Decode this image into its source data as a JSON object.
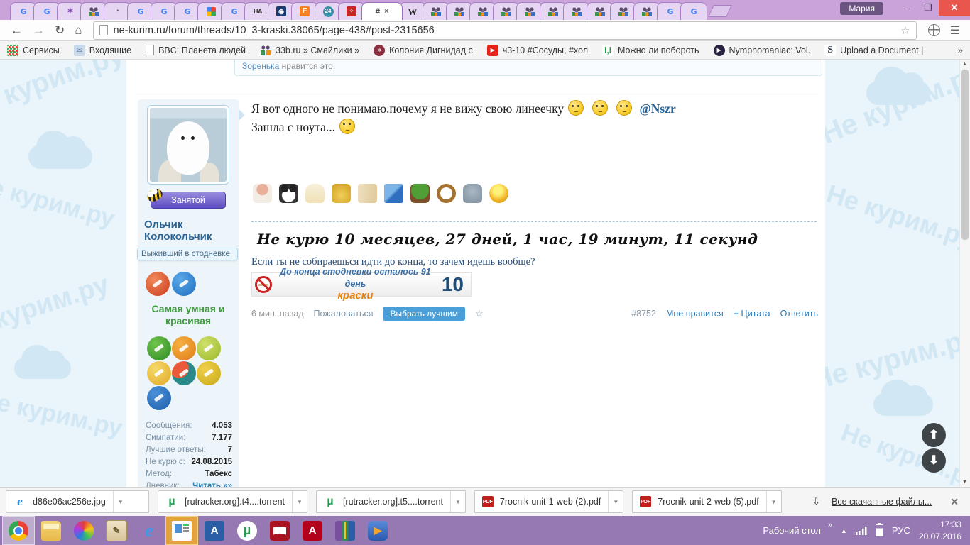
{
  "colors": {
    "titlebar": "#c9a3da",
    "taskbar": "#9679b2",
    "close": "#e8564e",
    "pagebg": "#e9f4fb",
    "wmcolor": "#d2e7f4",
    "green": "#3f9d3f",
    "orange": "#e8820c",
    "btnblue": "#4a9fd8"
  },
  "browser": {
    "profile_name": "Мария",
    "url": "ne-kurim.ru/forum/threads/10_3-kraski.38065/page-438#post-2315656",
    "active_tab_glyph": "#",
    "tab_close_glyph": "×",
    "win": {
      "min": "–",
      "max": "❐",
      "close": "✕"
    },
    "nav": {
      "back": "←",
      "fwd": "→",
      "reload": "↻",
      "home": "⌂",
      "star": "☆",
      "menu": "☰"
    },
    "tabs_before": [
      {
        "glyph": "G",
        "cls": "fav-google",
        "dn": "google-favicon"
      },
      {
        "glyph": "G",
        "cls": "fav-google",
        "dn": "google-favicon"
      },
      {
        "glyph": "✶",
        "cls": "fav-butterfly",
        "dn": "butterfly-favicon"
      },
      {
        "glyph": "",
        "cls": "fav-people",
        "dn": "forum-people-favicon"
      },
      {
        "glyph": "◔",
        "cls": "fav-circle-dark",
        "dn": "dark-circle-favicon"
      },
      {
        "glyph": "G",
        "cls": "fav-google",
        "dn": "google-favicon"
      },
      {
        "glyph": "G",
        "cls": "fav-google",
        "dn": "google-favicon"
      },
      {
        "glyph": "G",
        "cls": "fav-google",
        "dn": "google-favicon"
      },
      {
        "glyph": "",
        "cls": "fav-grid",
        "dn": "colored-grid-favicon"
      },
      {
        "glyph": "G",
        "cls": "fav-google",
        "dn": "google-favicon"
      },
      {
        "glyph": "НА",
        "cls": "fav-ha",
        "dn": "ha-favicon"
      },
      {
        "glyph": "◉",
        "cls": "fav-film",
        "dn": "film-favicon"
      },
      {
        "glyph": "F",
        "cls": "fav-f-orange",
        "dn": "f-orange-favicon"
      },
      {
        "glyph": "24",
        "cls": "fav-24",
        "dn": "24-favicon"
      },
      {
        "glyph": "⁘",
        "cls": "fav-red-app",
        "dn": "red-app-favicon"
      }
    ],
    "tabs_after": [
      {
        "glyph": "W",
        "cls": "fav-wiki",
        "dn": "wikipedia-favicon"
      },
      {
        "glyph": "",
        "cls": "fav-people",
        "dn": "forum-people-favicon"
      },
      {
        "glyph": "",
        "cls": "fav-people",
        "dn": "forum-people-favicon"
      },
      {
        "glyph": "",
        "cls": "fav-people",
        "dn": "forum-people-favicon"
      },
      {
        "glyph": "",
        "cls": "fav-people",
        "dn": "forum-people-favicon"
      },
      {
        "glyph": "",
        "cls": "fav-people",
        "dn": "forum-people-favicon"
      },
      {
        "glyph": "",
        "cls": "fav-people",
        "dn": "forum-people-favicon"
      },
      {
        "glyph": "",
        "cls": "fav-people",
        "dn": "forum-people-favicon"
      },
      {
        "glyph": "",
        "cls": "fav-people",
        "dn": "forum-people-favicon"
      },
      {
        "glyph": "",
        "cls": "fav-people",
        "dn": "forum-people-favicon"
      },
      {
        "glyph": "",
        "cls": "fav-people",
        "dn": "forum-people-favicon"
      },
      {
        "glyph": "G",
        "cls": "fav-google",
        "dn": "google-favicon"
      },
      {
        "glyph": "G",
        "cls": "fav-google",
        "dn": "google-favicon"
      }
    ],
    "bookmarks": [
      {
        "label": "Сервисы",
        "cls": "ic-apps",
        "glyph": "",
        "dn": "bookmark-services"
      },
      {
        "label": "Входящие",
        "cls": "ic-mail",
        "glyph": "✉",
        "dn": "bookmark-inbox"
      },
      {
        "label": "BBC: Планета людей",
        "cls": "ic-page",
        "glyph": "",
        "dn": "bookmark-bbc"
      },
      {
        "label": "33b.ru » Смайлики »",
        "cls": "ic-people",
        "glyph": "",
        "dn": "bookmark-33b"
      },
      {
        "label": "Колония Дигнидад с",
        "cls": "ic-chev",
        "glyph": "»",
        "dn": "bookmark-colonia"
      },
      {
        "label": "ч3-10 #Сосуды, #хол",
        "cls": "ic-yt",
        "glyph": "▶",
        "dn": "bookmark-youtube"
      },
      {
        "label": "Можно ли побороть",
        "cls": "ic-green",
        "glyph": "ǀ,ǀ",
        "dn": "bookmark-green"
      },
      {
        "label": "Nymphomaniac: Vol.",
        "cls": "ic-play",
        "glyph": "▶",
        "dn": "bookmark-nymphomaniac"
      },
      {
        "label": "Upload a Document |",
        "cls": "ic-scribd",
        "glyph": "S",
        "dn": "bookmark-scribd"
      }
    ],
    "bookmarks_overflow": "»"
  },
  "page": {
    "watermark_text": "Не курим.ру",
    "likebar": {
      "user": "Зоренька",
      "text": " нравится это."
    },
    "post": {
      "line1": "Я вот одного не понимаю.почему я не вижу свою линеечку",
      "mention": "@Nszr",
      "line2": "Зашла с ноута...",
      "trophies": [
        {
          "cls": "tr-nurse",
          "dn": "trophy-nurse-icon"
        },
        {
          "cls": "tr-panda",
          "dn": "trophy-panda-icon"
        },
        {
          "cls": "tr-cocktail",
          "dn": "trophy-cocktail-icon"
        },
        {
          "cls": "tr-coins",
          "dn": "trophy-coins-icon"
        },
        {
          "cls": "tr-scroll",
          "dn": "trophy-scroll-icon"
        },
        {
          "cls": "tr-pencil",
          "dn": "trophy-pencil-icon"
        },
        {
          "cls": "tr-tree",
          "dn": "trophy-bonsai-icon"
        },
        {
          "cls": "tr-wheel",
          "dn": "trophy-ship-wheel-icon"
        },
        {
          "cls": "tr-cat",
          "dn": "trophy-cat-icon"
        },
        {
          "cls": "tr-lamp",
          "dn": "trophy-lamp-icon"
        }
      ],
      "ticker": "Не курю 10 месяцев, 27 дней, 1 час, 19 минут, 11 секунд",
      "quote": "Если ты не собираешься идти до конца, то зачем идешь вообще?",
      "countdown_text": "До конца стодневки осталось 91 день",
      "countdown_sub": "краски",
      "countdown_number": "10",
      "footer": {
        "time_ago": "6 мин. назад",
        "report": "Пожаловаться",
        "best": "Выбрать лучшим",
        "star": "☆",
        "number": "#8752",
        "like": "Мне нравится",
        "quote": "+ Цитата",
        "reply": "Ответить"
      }
    },
    "user": {
      "status": "Занятой",
      "name": "Ольчик Колокольчик",
      "title": "Выживший в стодневке",
      "award_text": "Самая умная и красивая",
      "awards_top": [
        {
          "cls": "aw-red",
          "dn": "badge-strongman"
        },
        {
          "cls": "aw-blue",
          "dn": "badge-broken-cigarette-blue"
        }
      ],
      "awards_grid": [
        {
          "cls": "aw-green",
          "dn": "badge-runner"
        },
        {
          "cls": "aw-orange",
          "dn": "badge-broken-cigarette-orange"
        },
        {
          "cls": "aw-lime",
          "dn": "badge-aperture"
        },
        {
          "cls": "aw-gold",
          "dn": "badge-medal"
        },
        {
          "cls": "aw-multi",
          "dn": "badge-people"
        },
        {
          "cls": "aw-yellow",
          "dn": "badge-broken-cigarette-yellow"
        },
        {
          "cls": "aw-chat",
          "dn": "badge-chat-bubbles"
        }
      ],
      "stats": [
        {
          "label": "Сообщения:",
          "value": "4.053"
        },
        {
          "label": "Симпатии:",
          "value": "7.177"
        },
        {
          "label": "Лучшие ответы:",
          "value": "7"
        },
        {
          "label": "Не курю с:",
          "value": "24.08.2015"
        },
        {
          "label": "Метод:",
          "value": "Табекс"
        },
        {
          "label": "Дневник:",
          "value": "Читать »»",
          "cls": "stat-link"
        }
      ]
    },
    "scroll": {
      "up": "⬆",
      "down": "⬇"
    }
  },
  "downloads": {
    "items": [
      {
        "label": "d86e06ac256e.jpg",
        "cls": "dl-ie",
        "glyph": "e",
        "dn": "download-jpg"
      },
      {
        "label": "[rutracker.org].t4....torrent",
        "cls": "dl-ut",
        "glyph": "µ",
        "dn": "download-torrent"
      },
      {
        "label": "[rutracker.org].t5....torrent",
        "cls": "dl-ut",
        "glyph": "µ",
        "dn": "download-torrent"
      },
      {
        "label": "7rocnik-unit-1-web (2).pdf",
        "cls": "dl-pdf",
        "glyph": "PDF",
        "dn": "download-pdf"
      },
      {
        "label": "7rocnik-unit-2-web (5).pdf",
        "cls": "dl-pdf",
        "glyph": "PDF",
        "dn": "download-pdf"
      }
    ],
    "all_files": "Все скачанные файлы...",
    "tray_glyph": "⇩",
    "close_glyph": "✕",
    "caret": "▼"
  },
  "taskbar": {
    "icons": [
      {
        "cls": "ti-chrome",
        "slot": "hl",
        "glyph": "",
        "dn": "taskbar-chrome"
      },
      {
        "cls": "ti-folder",
        "glyph": "",
        "dn": "taskbar-explorer"
      },
      {
        "cls": "ti-sphere",
        "glyph": "",
        "dn": "taskbar-media-sphere"
      },
      {
        "cls": "ti-notes",
        "glyph": "✎",
        "dn": "taskbar-notes"
      },
      {
        "cls": "ti-ie",
        "glyph": "e",
        "dn": "taskbar-ie"
      },
      {
        "cls": "ti-viewer",
        "slot": "hl-orange",
        "glyph": "",
        "dn": "taskbar-active-viewer"
      },
      {
        "cls": "ti-appa",
        "glyph": "A",
        "dn": "taskbar-app-a"
      },
      {
        "cls": "ti-utorrent",
        "glyph": "µ",
        "dn": "taskbar-utorrent"
      },
      {
        "cls": "ti-reader",
        "glyph": "",
        "dn": "taskbar-reader"
      },
      {
        "cls": "ti-acrobat",
        "glyph": "A",
        "dn": "taskbar-acrobat"
      },
      {
        "cls": "ti-winrar",
        "glyph": "",
        "dn": "taskbar-winrar"
      },
      {
        "cls": "ti-player",
        "glyph": "▶",
        "dn": "taskbar-player"
      }
    ],
    "tray": {
      "desktop_label": "Рабочий стол",
      "desktop_chev": "»",
      "up": "▲",
      "lang": "РУС",
      "time": "17:33",
      "date": "20.07.2016"
    }
  }
}
